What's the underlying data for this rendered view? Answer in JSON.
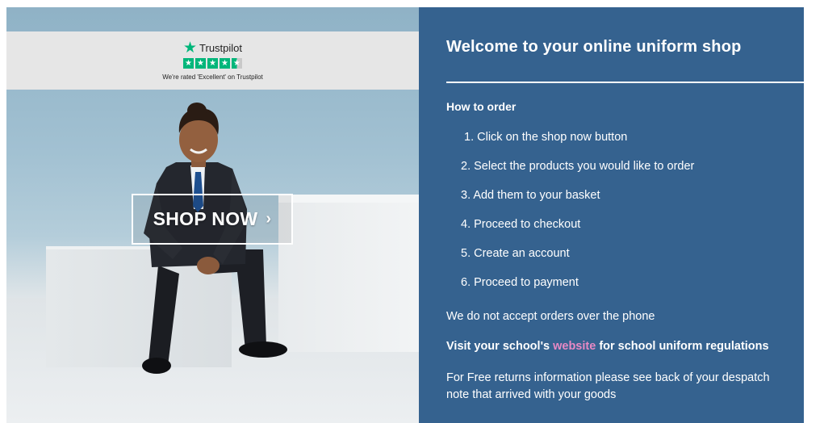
{
  "hero": {
    "trustpilot": {
      "brand": "Trustpilot",
      "caption": "We're rated 'Excellent' on Trustpilot",
      "rating_stars": 4.5,
      "star_color": "#00b67a"
    },
    "shop_button": {
      "label": "SHOP NOW",
      "chevron": "›"
    }
  },
  "panel": {
    "background": "#35628f",
    "welcome": "Welcome to your online uniform shop",
    "how_to_order": "How to order",
    "steps": [
      "1. Click on the shop now button",
      "2. Select the products you would like to order",
      "3. Add them to your basket",
      "4. Proceed to checkout",
      "5. Create an account",
      "6. Proceed to payment"
    ],
    "no_phone": "We do not accept orders over the phone",
    "visit_prefix": "Visit your school's ",
    "visit_link": "website",
    "visit_suffix": " for school uniform regulations",
    "link_color": "#e889c4",
    "returns": "For Free returns information please see back of your despatch note that arrived with your goods"
  }
}
